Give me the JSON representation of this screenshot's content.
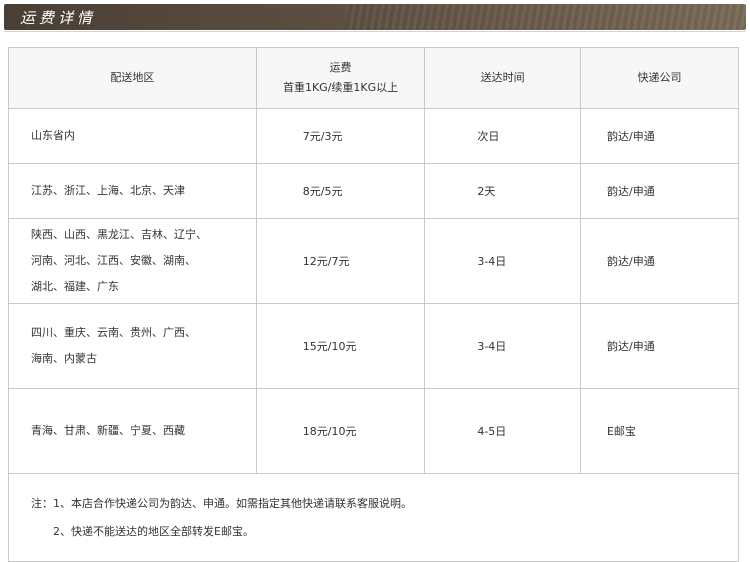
{
  "header": {
    "title": "运费详情"
  },
  "table": {
    "col_region": "配送地区",
    "col_fee_line1": "运费",
    "col_fee_line2": "首重1KG/续重1KG以上",
    "col_time": "送达时间",
    "col_courier": "快递公司",
    "rows": [
      {
        "region_lines": [
          "山东省内"
        ],
        "fee": "7元/3元",
        "time": "次日",
        "courier": "韵达/申通"
      },
      {
        "region_lines": [
          "江苏、浙江、上海、北京、天津"
        ],
        "fee": "8元/5元",
        "time": "2天",
        "courier": "韵达/申通"
      },
      {
        "region_lines": [
          "陕西、山西、黑龙江、吉林、辽宁、",
          "河南、河北、江西、安徽、湖南、",
          "湖北、福建、广东"
        ],
        "fee": "12元/7元",
        "time": "3-4日",
        "courier": "韵达/申通"
      },
      {
        "region_lines": [
          "四川、重庆、云南、贵州、广西、",
          "海南、内蒙古"
        ],
        "fee": "15元/10元",
        "time": "3-4日",
        "courier": "韵达/申通"
      },
      {
        "region_lines": [
          "青海、甘肃、新疆、宁夏、西藏"
        ],
        "fee": "18元/10元",
        "time": "4-5日",
        "courier": "E邮宝"
      }
    ],
    "notes": [
      "注：1、本店合作快递公司为韵达、申通。如需指定其他快递请联系客服说明。",
      "2、快递不能送达的地区全部转发E邮宝。"
    ]
  }
}
